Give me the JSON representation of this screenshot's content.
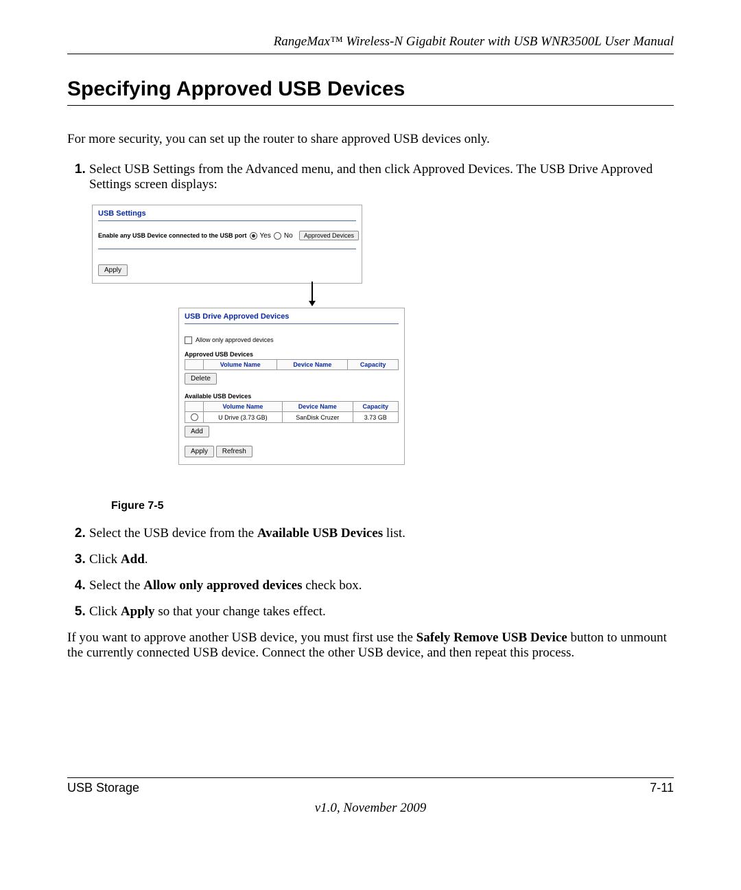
{
  "header": {
    "running_title": "RangeMax™ Wireless-N Gigabit Router with USB WNR3500L User Manual"
  },
  "section": {
    "title": "Specifying Approved USB Devices",
    "intro": "For more security, you can set up the router to share approved USB devices only."
  },
  "steps": {
    "s1a": "Select USB Settings from the Advanced menu, and then click Approved Devices. The USB Drive Approved Settings screen displays:",
    "s2a": "Select the USB device from the ",
    "s2b": "Available USB Devices",
    "s2c": " list.",
    "s3a": "Click ",
    "s3b": "Add",
    "s3c": ".",
    "s4a": "Select the ",
    "s4b": "Allow only approved devices",
    "s4c": " check box.",
    "s5a": "Click ",
    "s5b": "Apply",
    "s5c": " so that your change takes effect."
  },
  "figure": {
    "caption": "Figure 7-5"
  },
  "usb_settings": {
    "title": "USB Settings",
    "enable_label": "Enable any USB Device connected to the USB port",
    "yes": "Yes",
    "no": "No",
    "approved_btn": "Approved Devices",
    "apply": "Apply"
  },
  "approved_panel": {
    "title": "USB Drive Approved Devices",
    "allow_only": "Allow only approved devices",
    "approved_label": "Approved USB Devices",
    "available_label": "Available USB Devices",
    "headers": {
      "volume": "Volume Name",
      "device": "Device Name",
      "capacity": "Capacity"
    },
    "row": {
      "volume": "U Drive (3.73 GB)",
      "device": "SanDisk Cruzer",
      "capacity": "3.73 GB"
    },
    "delete_btn": "Delete",
    "add_btn": "Add",
    "apply_btn": "Apply",
    "refresh_btn": "Refresh"
  },
  "note": {
    "p1": "If you want to approve another USB device, you must first use the ",
    "p2": "Safely Remove USB Device",
    "p3": " button to unmount the currently connected USB device. Connect the other USB device, and then repeat this process."
  },
  "footer": {
    "left": "USB Storage",
    "right": "7-11",
    "version": "v1.0, November 2009"
  }
}
